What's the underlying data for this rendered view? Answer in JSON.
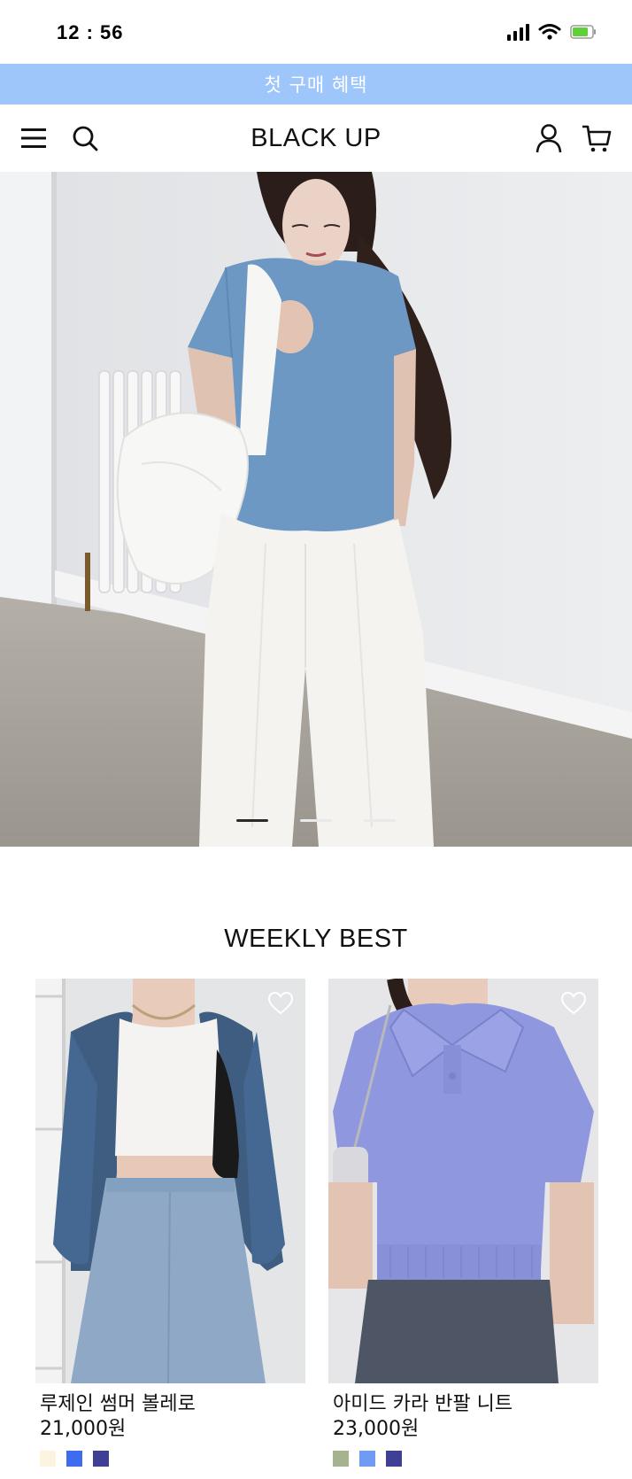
{
  "status_bar": {
    "time": "12 : 56"
  },
  "promo": {
    "text": "첫 구매 혜택"
  },
  "header": {
    "brand": "BLACK UP"
  },
  "hero": {
    "slide_count": 3,
    "active_slide": 1
  },
  "weekly_best": {
    "title": "WEEKLY BEST",
    "products": [
      {
        "name": "루제인 썸머 볼레로",
        "price": "21,000원",
        "swatches": [
          "#fdf3e1",
          "#3e6bf0",
          "#3f3f96"
        ]
      },
      {
        "name": "아미드 카라 반팔 니트",
        "price": "23,000원",
        "swatches": [
          "#a7b38f",
          "#6f9bf5",
          "#3f3f96"
        ]
      }
    ]
  },
  "colors": {
    "promo_bg": "#9ec6fb",
    "accent_text": "#111111"
  },
  "icons": {
    "menu": "menu-icon",
    "search": "search-icon",
    "account": "user-icon",
    "cart": "cart-icon",
    "wishlist": "heart-icon"
  }
}
